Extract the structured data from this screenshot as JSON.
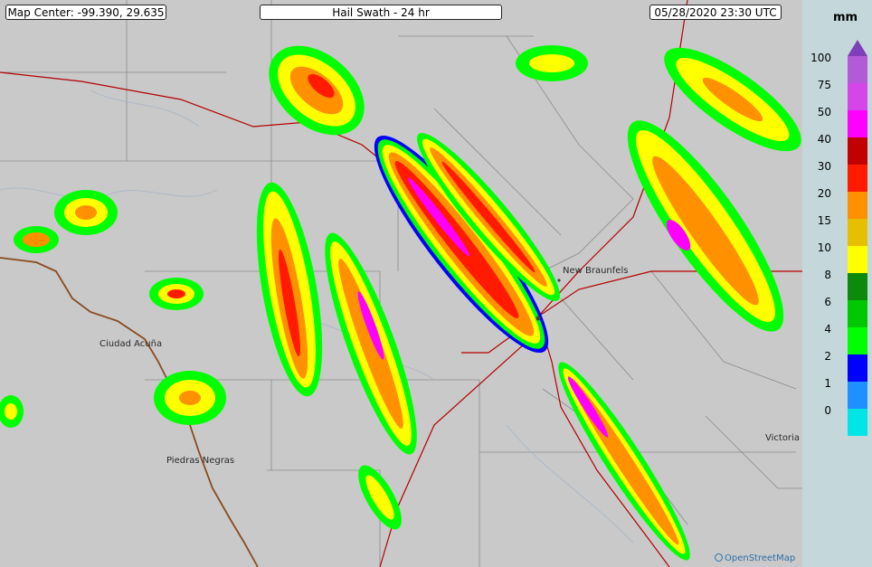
{
  "header": {
    "map_center": "Map Center: -99.390, 29.635",
    "title": "Hail Swath - 24 hr",
    "timestamp": "05/28/2020   23:30 UTC"
  },
  "cities": [
    {
      "id": "new-braunfels",
      "name": "New Braunfels"
    },
    {
      "id": "ciudad-acuna",
      "name": "Ciudad Acuña"
    },
    {
      "id": "piedras-negras",
      "name": "Piedras Negras"
    },
    {
      "id": "victoria",
      "name": "Victoria"
    }
  ],
  "attribution": "OpenStreetMap",
  "legend": {
    "unit": "mm",
    "entries": [
      {
        "label": "100",
        "color": "#b35ad6"
      },
      {
        "label": "75",
        "color": "#d645e8"
      },
      {
        "label": "50",
        "color": "#ff00ff"
      },
      {
        "label": "40",
        "color": "#c20000"
      },
      {
        "label": "30",
        "color": "#ff1a00"
      },
      {
        "label": "20",
        "color": "#ff9100"
      },
      {
        "label": "15",
        "color": "#e5bf00"
      },
      {
        "label": "10",
        "color": "#ffff00"
      },
      {
        "label": "8",
        "color": "#0b8a0b"
      },
      {
        "label": "6",
        "color": "#00c800"
      },
      {
        "label": "4",
        "color": "#00ff00"
      },
      {
        "label": "2",
        "color": "#0000ff"
      },
      {
        "label": "1",
        "color": "#1e90ff"
      },
      {
        "label": "0",
        "color": "#00e5e5"
      }
    ],
    "overflow_arrow_color": "#7e3fb8"
  }
}
